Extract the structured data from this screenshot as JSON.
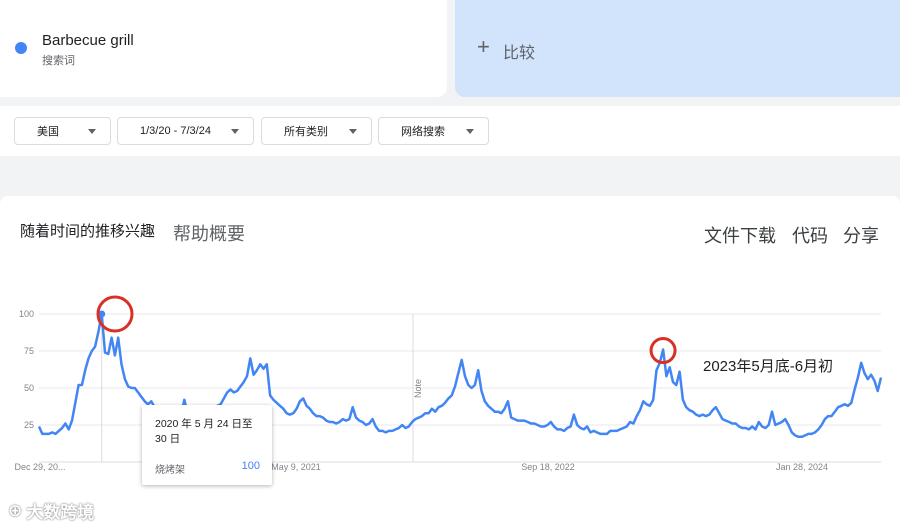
{
  "search_term": {
    "name": "Barbecue grill",
    "subtitle": "搜索词",
    "color": "#4285f4"
  },
  "compare": {
    "label": "比较"
  },
  "filters": [
    {
      "label": "美国"
    },
    {
      "label": "1/3/20 - 7/3/24"
    },
    {
      "label": "所有类别"
    },
    {
      "label": "网络搜索"
    }
  ],
  "chart_header": {
    "title": "随着时间的推移兴趣",
    "help": "帮助概要",
    "actions": [
      "文件下载",
      "代码",
      "分享"
    ]
  },
  "tooltip": {
    "date": "2020 年 5 月 24 日至 30 日",
    "series_name": "烧烤架",
    "value": "100"
  },
  "annotation": "2023年5月底-6月初",
  "watermark": "大数跨境",
  "chart_data": {
    "type": "line",
    "ylim": [
      0,
      100
    ],
    "y_ticks": [
      100,
      75,
      50,
      25
    ],
    "x_tick_labels": [
      "Dec 29, 20...",
      "May 9, 2021",
      "Sep 18, 2022",
      "Jan 28, 2024"
    ],
    "note_label": "Note",
    "line_color": "#4285f4",
    "highlight_color": "#d93025",
    "series": [
      {
        "values": [
          24,
          19,
          19,
          19,
          20,
          19,
          21,
          23,
          26,
          22,
          28,
          40,
          52,
          52,
          62,
          70,
          75,
          78,
          88,
          100,
          74,
          73,
          84,
          72,
          84,
          66,
          56,
          51,
          50,
          50,
          47,
          44,
          41,
          39,
          41,
          37,
          33,
          31,
          31,
          33,
          31,
          33,
          29,
          31,
          42,
          33,
          31,
          29,
          33,
          30,
          28,
          27,
          27,
          32,
          38,
          39,
          43,
          47,
          49,
          47,
          48,
          51,
          54,
          58,
          70,
          59,
          62,
          66,
          63,
          66,
          45,
          42,
          40,
          38,
          36,
          33,
          32,
          33,
          36,
          41,
          43,
          38,
          36,
          33,
          31,
          31,
          30,
          28,
          27,
          27,
          26,
          27,
          29,
          28,
          29,
          37,
          30,
          28,
          27,
          25,
          26,
          29,
          24,
          21,
          21,
          20,
          21,
          21,
          22,
          23,
          25,
          23,
          24,
          27,
          29,
          30,
          31,
          33,
          33,
          36,
          34,
          37,
          38,
          40,
          43,
          45,
          51,
          60,
          69,
          58,
          52,
          50,
          52,
          62,
          48,
          41,
          38,
          36,
          34,
          34,
          33,
          36,
          41,
          30,
          29,
          28,
          28,
          28,
          27,
          26,
          26,
          25,
          24,
          24,
          25,
          27,
          24,
          22,
          22,
          21,
          23,
          24,
          32,
          25,
          23,
          22,
          24,
          20,
          21,
          20,
          19,
          19,
          19,
          21,
          21,
          21,
          22,
          23,
          24,
          27,
          26,
          31,
          35,
          41,
          39,
          38,
          42,
          62,
          67,
          76,
          58,
          64,
          54,
          52,
          61,
          42,
          37,
          35,
          34,
          32,
          31,
          32,
          31,
          32,
          35,
          37,
          33,
          29,
          28,
          27,
          26,
          26,
          24,
          23,
          23,
          22,
          24,
          22,
          27,
          24,
          23,
          25,
          34,
          25,
          26,
          27,
          29,
          25,
          20,
          18,
          17,
          17,
          18,
          19,
          19,
          20,
          22,
          25,
          29,
          31,
          31,
          34,
          37,
          38,
          39,
          38,
          40,
          49,
          57,
          67,
          60,
          56,
          59,
          55,
          48,
          57
        ]
      }
    ]
  }
}
